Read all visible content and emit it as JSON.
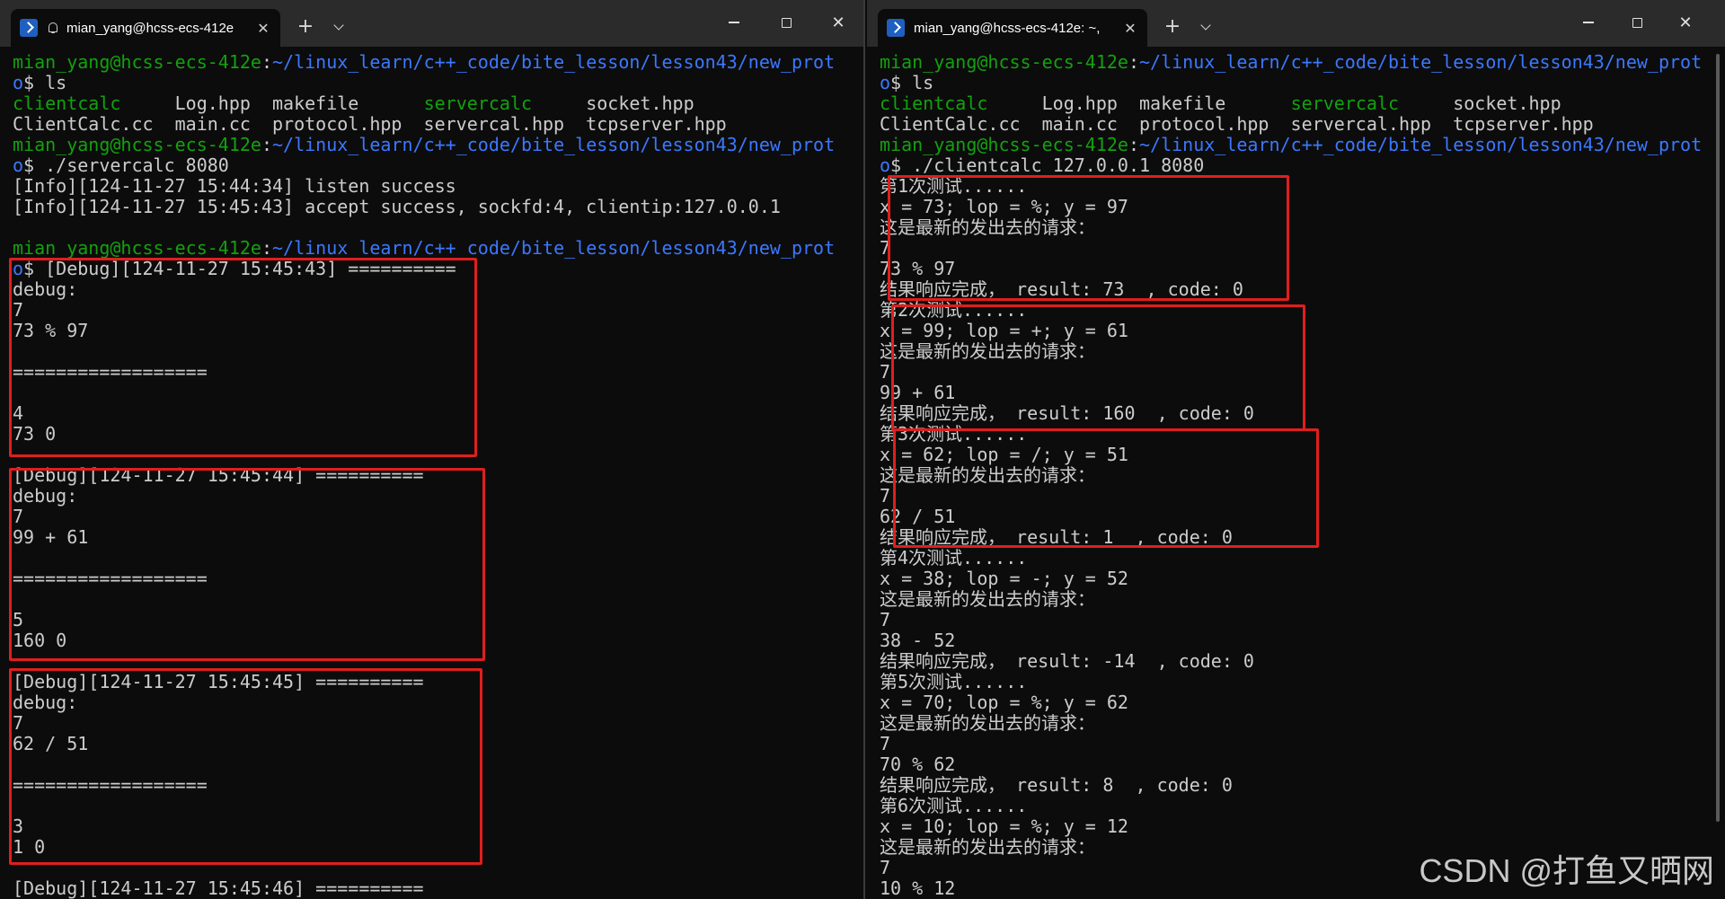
{
  "left_window": {
    "tab_title": "mian_yang@hcss-ecs-412e",
    "icons": {
      "app": "powershell-icon",
      "bell": "bell-icon",
      "close": "close-icon",
      "new_tab": "plus-icon",
      "dropdown": "chevron-down-icon"
    },
    "new_tab_label": "+",
    "close_label": "✕",
    "lines": [
      [
        {
          "t": "mian_yang@hcss-ecs-412e",
          "c": "u"
        },
        {
          "t": ":",
          "c": ""
        },
        {
          "t": "~/linux_learn/c++_code/bite_lesson/lesson43/new_prot",
          "c": "p"
        }
      ],
      [
        {
          "t": "o",
          "c": "p"
        },
        {
          "t": "$ ls",
          "c": ""
        }
      ],
      [
        {
          "t": "clientcalc",
          "c": "g"
        },
        {
          "t": "     Log.hpp  makefile      ",
          "c": ""
        },
        {
          "t": "servercalc",
          "c": "g"
        },
        {
          "t": "     socket.hpp",
          "c": ""
        }
      ],
      [
        {
          "t": "ClientCalc.cc  main.cc  protocol.hpp  servercal.hpp  tcpserver.hpp",
          "c": ""
        }
      ],
      [
        {
          "t": "mian_yang@hcss-ecs-412e",
          "c": "u"
        },
        {
          "t": ":",
          "c": ""
        },
        {
          "t": "~/linux_learn/c++_code/bite_lesson/lesson43/new_prot",
          "c": "p"
        }
      ],
      [
        {
          "t": "o",
          "c": "p"
        },
        {
          "t": "$ ./servercalc 8080",
          "c": ""
        }
      ],
      [
        {
          "t": "[Info][124-11-27 15:44:34] listen success",
          "c": ""
        }
      ],
      [
        {
          "t": "[Info][124-11-27 15:45:43] accept success, sockfd:4, clientip:127.0.0.1",
          "c": ""
        }
      ],
      [],
      [
        {
          "t": "mian_yang@hcss-ecs-412e",
          "c": "u"
        },
        {
          "t": ":",
          "c": ""
        },
        {
          "t": "~/linux_learn/c++_code/bite_lesson/lesson43/new_prot",
          "c": "p"
        }
      ],
      [
        {
          "t": "o",
          "c": "p"
        },
        {
          "t": "$ [Debug][124-11-27 15:45:43] ==========",
          "c": ""
        }
      ],
      [
        {
          "t": "debug:",
          "c": ""
        }
      ],
      [
        {
          "t": "7",
          "c": ""
        }
      ],
      [
        {
          "t": "73 % 97",
          "c": ""
        }
      ],
      [],
      [
        {
          "t": "==================",
          "c": ""
        }
      ],
      [],
      [
        {
          "t": "4",
          "c": ""
        }
      ],
      [
        {
          "t": "73 0",
          "c": ""
        }
      ],
      [],
      [
        {
          "t": "[Debug][124-11-27 15:45:44] ==========",
          "c": ""
        }
      ],
      [
        {
          "t": "debug:",
          "c": ""
        }
      ],
      [
        {
          "t": "7",
          "c": ""
        }
      ],
      [
        {
          "t": "99 + 61",
          "c": ""
        }
      ],
      [],
      [
        {
          "t": "==================",
          "c": ""
        }
      ],
      [],
      [
        {
          "t": "5",
          "c": ""
        }
      ],
      [
        {
          "t": "160 0",
          "c": ""
        }
      ],
      [],
      [
        {
          "t": "[Debug][124-11-27 15:45:45] ==========",
          "c": ""
        }
      ],
      [
        {
          "t": "debug:",
          "c": ""
        }
      ],
      [
        {
          "t": "7",
          "c": ""
        }
      ],
      [
        {
          "t": "62 / 51",
          "c": ""
        }
      ],
      [],
      [
        {
          "t": "==================",
          "c": ""
        }
      ],
      [],
      [
        {
          "t": "3",
          "c": ""
        }
      ],
      [
        {
          "t": "1 0",
          "c": ""
        }
      ],
      [],
      [
        {
          "t": "[Debug][124-11-27 15:45:46] ==========",
          "c": ""
        }
      ]
    ]
  },
  "right_window": {
    "tab_title": "mian_yang@hcss-ecs-412e: ~,",
    "icons": {
      "app": "powershell-icon",
      "close": "close-icon",
      "new_tab": "plus-icon",
      "dropdown": "chevron-down-icon"
    },
    "new_tab_label": "+",
    "close_label": "✕",
    "lines": [
      [
        {
          "t": "mian_yang@hcss-ecs-412e",
          "c": "u"
        },
        {
          "t": ":",
          "c": ""
        },
        {
          "t": "~/linux_learn/c++_code/bite_lesson/lesson43/new_prot",
          "c": "p"
        }
      ],
      [
        {
          "t": "o",
          "c": "p"
        },
        {
          "t": "$ ls",
          "c": ""
        }
      ],
      [
        {
          "t": "clientcalc",
          "c": "g"
        },
        {
          "t": "     Log.hpp  makefile      ",
          "c": ""
        },
        {
          "t": "servercalc",
          "c": "g"
        },
        {
          "t": "     socket.hpp",
          "c": ""
        }
      ],
      [
        {
          "t": "ClientCalc.cc  main.cc  protocol.hpp  servercal.hpp  tcpserver.hpp",
          "c": ""
        }
      ],
      [
        {
          "t": "mian_yang@hcss-ecs-412e",
          "c": "u"
        },
        {
          "t": ":",
          "c": ""
        },
        {
          "t": "~/linux_learn/c++_code/bite_lesson/lesson43/new_prot",
          "c": "p"
        }
      ],
      [
        {
          "t": "o",
          "c": "p"
        },
        {
          "t": "$ ./clientcalc 127.0.0.1 8080",
          "c": ""
        }
      ],
      [
        {
          "t": "第1次测试......",
          "c": ""
        }
      ],
      [
        {
          "t": "x = 73; lop = %; y = 97",
          "c": ""
        }
      ],
      [
        {
          "t": "这是最新的发出去的请求：",
          "c": ""
        }
      ],
      [
        {
          "t": "7",
          "c": ""
        }
      ],
      [
        {
          "t": "73 % 97",
          "c": ""
        }
      ],
      [
        {
          "t": "结果响应完成， result: 73  , code: 0",
          "c": ""
        }
      ],
      [
        {
          "t": "第2次测试......",
          "c": ""
        }
      ],
      [
        {
          "t": "x = 99; lop = +; y = 61",
          "c": ""
        }
      ],
      [
        {
          "t": "这是最新的发出去的请求：",
          "c": ""
        }
      ],
      [
        {
          "t": "7",
          "c": ""
        }
      ],
      [
        {
          "t": "99 + 61",
          "c": ""
        }
      ],
      [
        {
          "t": "结果响应完成， result: 160  , code: 0",
          "c": ""
        }
      ],
      [
        {
          "t": "第3次测试......",
          "c": ""
        }
      ],
      [
        {
          "t": "x = 62; lop = /; y = 51",
          "c": ""
        }
      ],
      [
        {
          "t": "这是最新的发出去的请求：",
          "c": ""
        }
      ],
      [
        {
          "t": "7",
          "c": ""
        }
      ],
      [
        {
          "t": "62 / 51",
          "c": ""
        }
      ],
      [
        {
          "t": "结果响应完成， result: 1  , code: 0",
          "c": ""
        }
      ],
      [
        {
          "t": "第4次测试......",
          "c": ""
        }
      ],
      [
        {
          "t": "x = 38; lop = -; y = 52",
          "c": ""
        }
      ],
      [
        {
          "t": "这是最新的发出去的请求：",
          "c": ""
        }
      ],
      [
        {
          "t": "7",
          "c": ""
        }
      ],
      [
        {
          "t": "38 - 52",
          "c": ""
        }
      ],
      [
        {
          "t": "结果响应完成， result: -14  , code: 0",
          "c": ""
        }
      ],
      [
        {
          "t": "第5次测试......",
          "c": ""
        }
      ],
      [
        {
          "t": "x = 70; lop = %; y = 62",
          "c": ""
        }
      ],
      [
        {
          "t": "这是最新的发出去的请求：",
          "c": ""
        }
      ],
      [
        {
          "t": "7",
          "c": ""
        }
      ],
      [
        {
          "t": "70 % 62",
          "c": ""
        }
      ],
      [
        {
          "t": "结果响应完成， result: 8  , code: 0",
          "c": ""
        }
      ],
      [
        {
          "t": "第6次测试......",
          "c": ""
        }
      ],
      [
        {
          "t": "x = 10; lop = %; y = 12",
          "c": ""
        }
      ],
      [
        {
          "t": "这是最新的发出去的请求：",
          "c": ""
        }
      ],
      [
        {
          "t": "7",
          "c": ""
        }
      ],
      [
        {
          "t": "10 % 12",
          "c": ""
        }
      ]
    ]
  },
  "colors": {
    "background": "#0c0c0c",
    "text": "#cccccc",
    "user_host": "#13a10e",
    "path": "#3b78ff",
    "executable": "#13a10e",
    "highlight_box": "#e01e1e",
    "titlebar": "#2b2b2b"
  },
  "watermark": "CSDN @打鱼又晒网"
}
